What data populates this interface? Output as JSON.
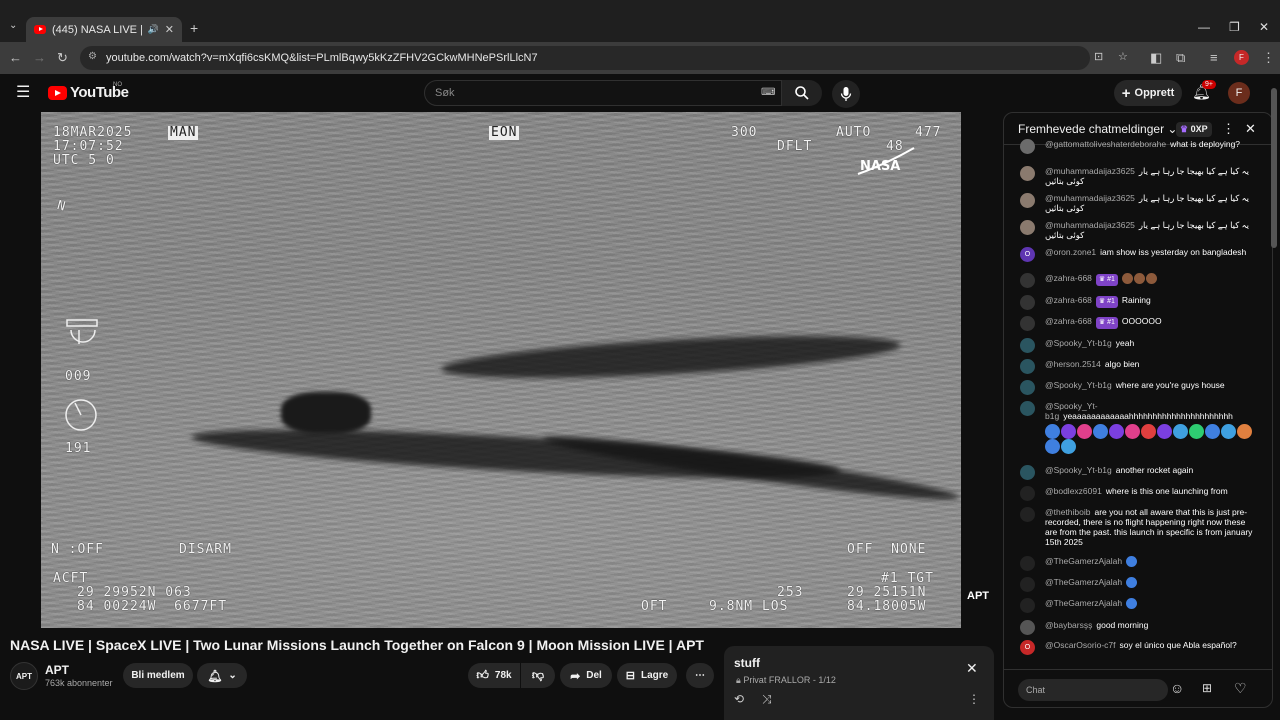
{
  "browser": {
    "tab_title": "(445) NASA LIVE | SpaceX LI",
    "url": "youtube.com/watch?v=mXqfi6csKMQ&list=PLmlBqwy5kKzZFHV2GCkwMHNePSrlLlcN7",
    "new_tab_label": "+"
  },
  "youtube_header": {
    "logo_text": "YouTube",
    "country_code": "NO",
    "search_placeholder": "Søk",
    "create_label": "Opprett",
    "notification_count": "9+",
    "avatar_letter": "F"
  },
  "video": {
    "osd": {
      "date": "18MAR2025",
      "mode": "MAN",
      "time": "17:07:52",
      "utc": "UTC 5 0",
      "center_tag": "EON",
      "top_right_1": "300",
      "top_right_auto": "AUTO",
      "top_right_477": "477",
      "dflt": "DFLT",
      "dflt_value": "48",
      "north": "N",
      "readout_009": "009",
      "readout_191": "191",
      "n_off": "N :OFF",
      "disarm": "DISARM",
      "off_none": "OFF  NONE",
      "acft": "ACFT",
      "acft_lat": "29 29952N 063",
      "acft_lon": "84 00224W  6677FT",
      "tgt": "#1 TGT",
      "range": "253",
      "tgt_lat": "29 25151N",
      "oft": "OFT",
      "los": "9.8NM LOS",
      "tgt_lon": "84.18005W",
      "watermark": "APT"
    },
    "title": "NASA LIVE | SpaceX LIVE | Two Lunar Missions Launch Together on Falcon 9 | Moon Mission LIVE | APT"
  },
  "channel": {
    "avatar_text": "APT",
    "name": "APT",
    "subscribers": "763k abonnenter",
    "join_label": "Bli medlem"
  },
  "actions": {
    "likes": "78k",
    "share_label": "Del",
    "save_label": "Lagre"
  },
  "playlist": {
    "title": "stuff",
    "privacy": "Privat",
    "owner_progress": "FRALLOR - 1/12"
  },
  "chat": {
    "header_title": "Fremhevede chatmeldinger",
    "xp_label": "0XP",
    "input_placeholder": "Chat",
    "messages": [
      {
        "user": "@gattomattoliveshaterdeborahe",
        "text": "what is deploying?",
        "avatar": "#6b6b6b"
      },
      {
        "user": "@muhammadaijaz3625",
        "text": "یہ کیا ہے کیا بھیجا جا رہا ہے یار کوئی بتائیں",
        "avatar": "#8a7a6e"
      },
      {
        "user": "@muhammadaijaz3625",
        "text": "یہ کیا ہے کیا بھیجا جا رہا ہے یار کوئی بتائیں",
        "avatar": "#8a7a6e"
      },
      {
        "user": "@muhammadaijaz3625",
        "text": "یہ کیا ہے کیا بھیجا جا رہا ہے یار کوئی بتائیں",
        "avatar": "#8a7a6e"
      },
      {
        "user": "@oron.zone1",
        "text": "iam show iss yesterday on bangladesh",
        "avatar": "#5e35b1",
        "avatar_letter": "O"
      },
      {
        "user": "@zahra-668",
        "badge": "#1",
        "text": "",
        "avatar": "#333"
      },
      {
        "user": "@zahra-668",
        "badge": "#1",
        "text": "Raining",
        "avatar": "#333"
      },
      {
        "user": "@zahra-668",
        "badge": "#1",
        "text": "OOOOOO",
        "avatar": "#333"
      },
      {
        "user": "@Spooky_Yt-b1g",
        "text": "yeah",
        "avatar": "#2a5560"
      },
      {
        "user": "@herson.2514",
        "text": "algo bien",
        "avatar": "#2a5560"
      },
      {
        "user": "@Spooky_Yt-b1g",
        "text": "where are you're guys house",
        "avatar": "#2a5560"
      },
      {
        "user": "@Spooky_Yt-b1g",
        "text": "yeaaaaaaaaaaaahhhhhhhhhhhhhhhhhhhhhh",
        "avatar": "#2a5560"
      },
      {
        "user": "@Spooky_Yt-b1g",
        "text": "another rocket again",
        "avatar": "#2a5560"
      },
      {
        "user": "@bodlexz6091",
        "text": "where is this one launching from",
        "avatar": "#222"
      },
      {
        "user": "@thethiboib",
        "text": "are you not all aware that this is just pre-recorded, there is no flight happening right now these are from the past. this launch in specific is from january 15th 2025",
        "avatar": "#222"
      },
      {
        "user": "@TheGamerzAjalah",
        "text": "",
        "avatar": "#222"
      },
      {
        "user": "@TheGamerzAjalah",
        "text": "",
        "avatar": "#222"
      },
      {
        "user": "@TheGamerzAjalah",
        "text": "",
        "avatar": "#222"
      },
      {
        "user": "@baybarsşş",
        "text": "good morning",
        "avatar": "#555"
      },
      {
        "user": "@OscarOsorio-c7f",
        "text": "soy el único que Abla español?",
        "avatar": "#c62828",
        "avatar_letter": "O"
      }
    ]
  }
}
